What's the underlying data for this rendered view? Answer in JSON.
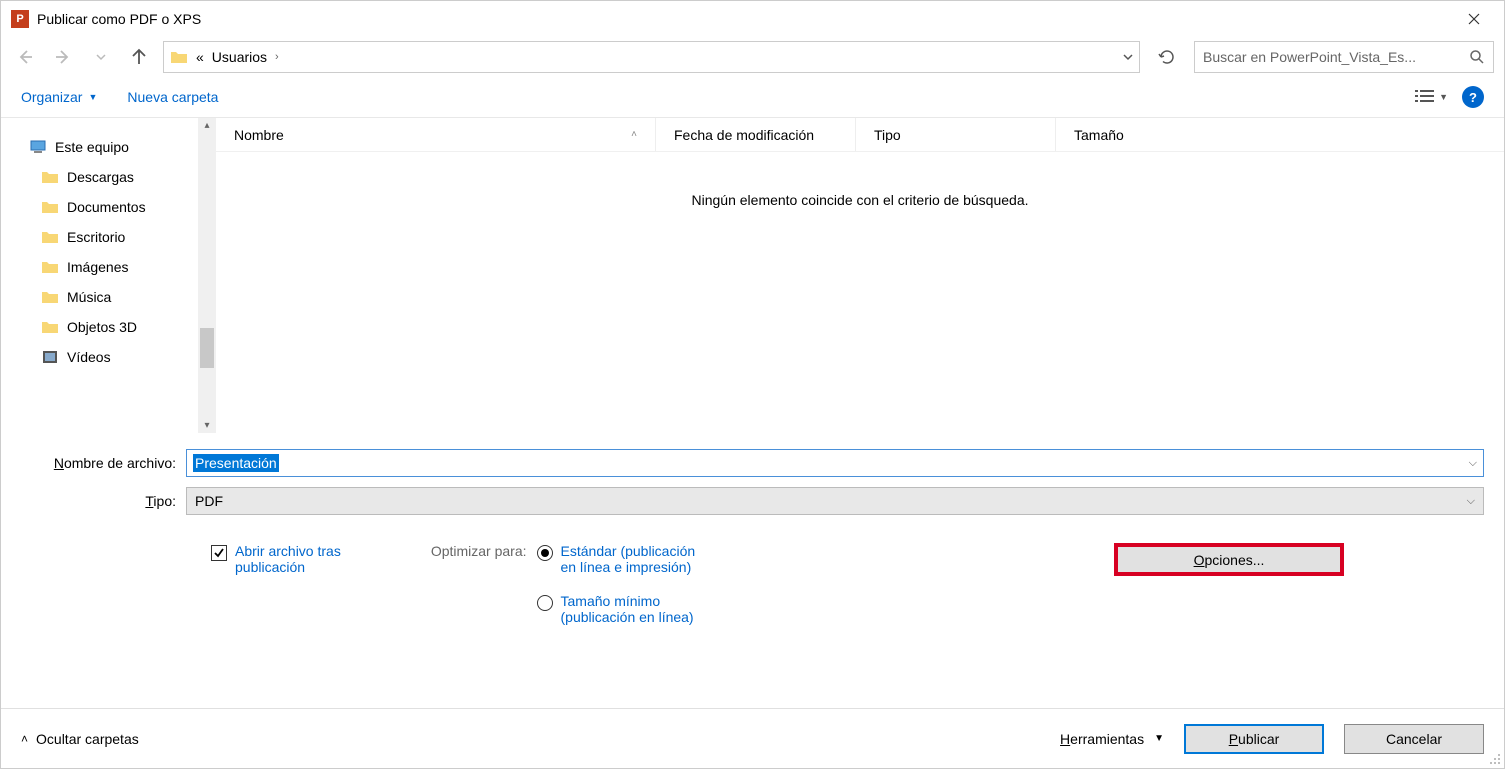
{
  "title": "Publicar como PDF o XPS",
  "breadcrumb": {
    "prefix": "«",
    "segment": "Usuarios",
    "suffix": "›"
  },
  "search": {
    "placeholder": "Buscar en PowerPoint_Vista_Es..."
  },
  "toolbar": {
    "organize": "Organizar",
    "new_folder": "Nueva carpeta"
  },
  "sidebar": {
    "items": [
      {
        "label": "Este equipo",
        "icon": "pc"
      },
      {
        "label": "Descargas",
        "icon": "folder"
      },
      {
        "label": "Documentos",
        "icon": "folder"
      },
      {
        "label": "Escritorio",
        "icon": "folder"
      },
      {
        "label": "Imágenes",
        "icon": "folder"
      },
      {
        "label": "Música",
        "icon": "folder"
      },
      {
        "label": "Objetos 3D",
        "icon": "folder"
      },
      {
        "label": "Vídeos",
        "icon": "video"
      }
    ]
  },
  "columns": {
    "name": "Nombre",
    "date": "Fecha de modificación",
    "type": "Tipo",
    "size": "Tamaño"
  },
  "empty_message": "Ningún elemento coincide con el criterio de búsqueda.",
  "form": {
    "filename_label_pre": "N",
    "filename_label_post": "ombre de archivo:",
    "filename_value": "Presentación",
    "type_label_pre": "T",
    "type_label_post": "ipo:",
    "type_value": "PDF"
  },
  "checkbox": {
    "line1_pre": "A",
    "line1_post": "brir archivo tras",
    "line2": "publicación"
  },
  "optimize": {
    "label": "Optimizar para:",
    "opt1_line1": "Estándar (publicación",
    "opt1_line2": "en línea e impresión)",
    "opt2_line1_pre": "T",
    "opt2_line1_post": "amaño mínimo",
    "opt2_line2": "(publicación en línea)"
  },
  "options_btn_pre": "O",
  "options_btn_post": "pciones...",
  "footer": {
    "hide_folders": "Ocultar carpetas",
    "tools_pre": "H",
    "tools_post": "erramientas",
    "publish_pre": "P",
    "publish_post": "ublicar",
    "cancel": "Cancelar"
  }
}
